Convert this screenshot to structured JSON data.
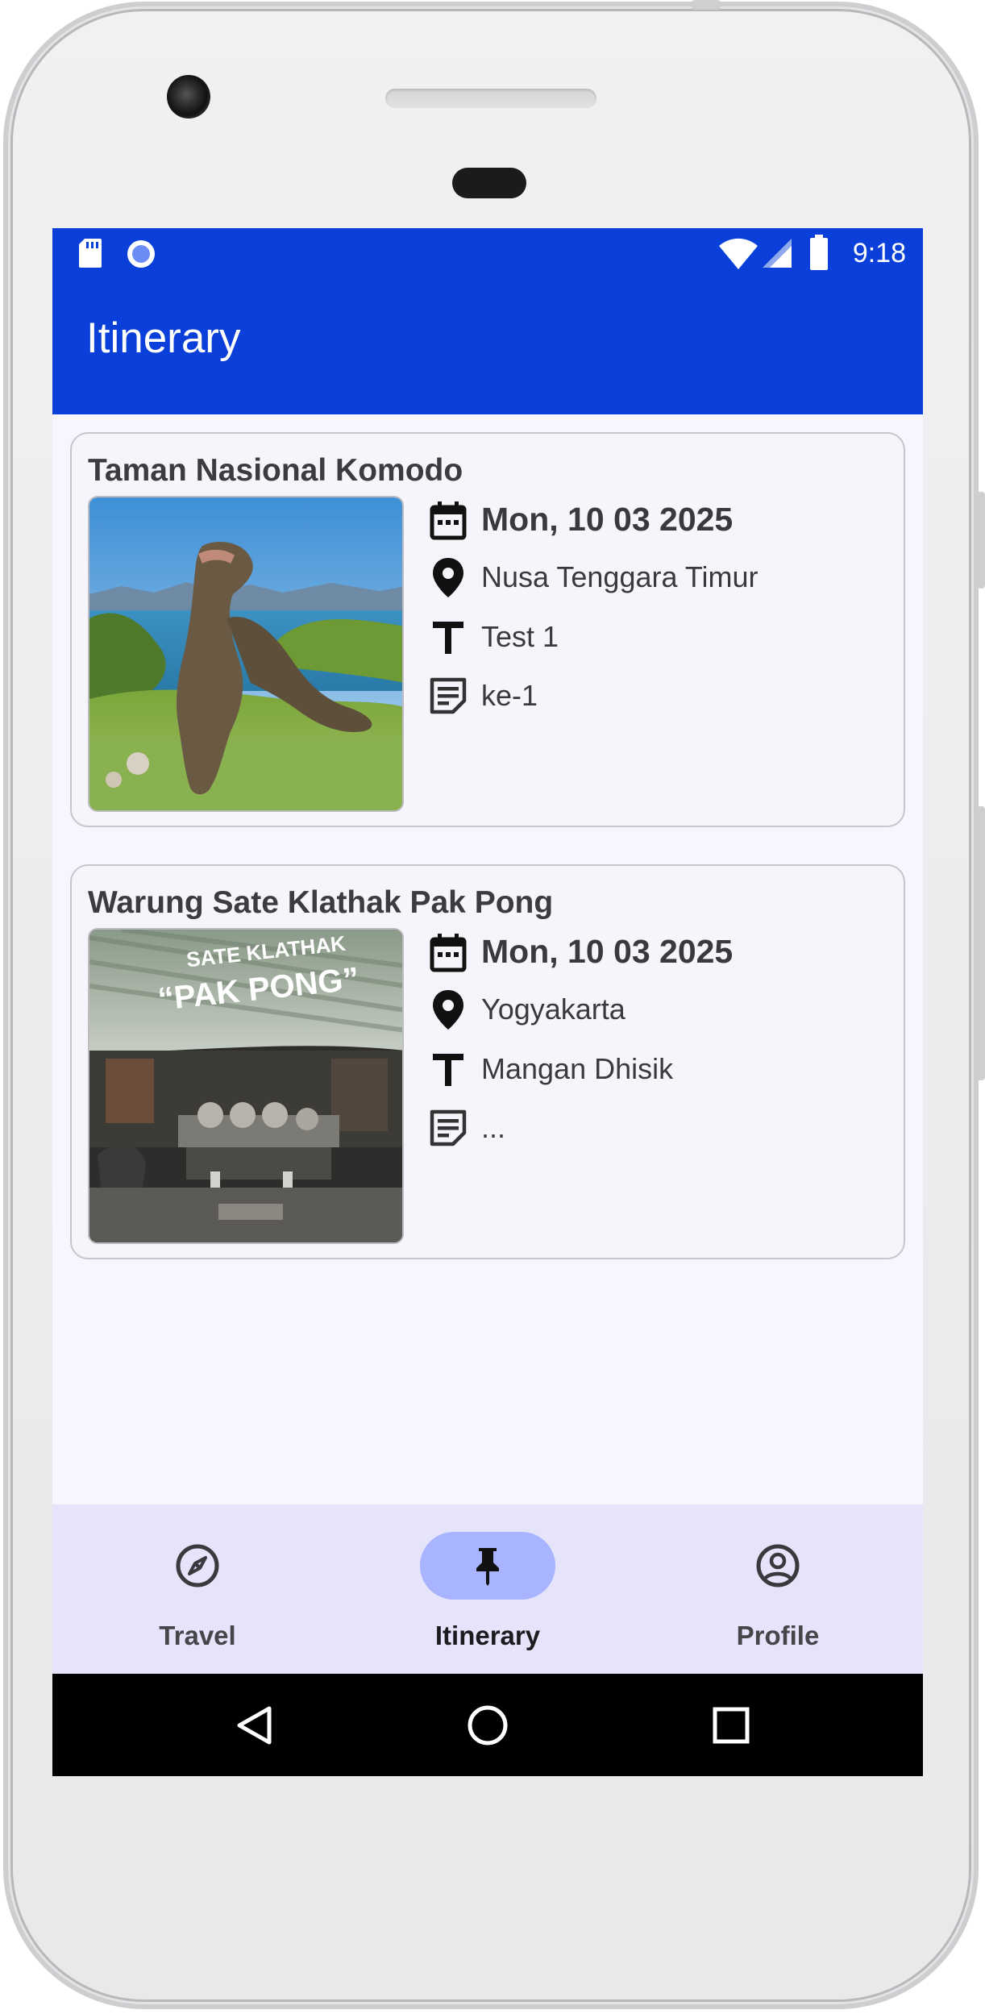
{
  "status_bar": {
    "time": "9:18"
  },
  "app_bar": {
    "title": "Itinerary"
  },
  "itineraries": [
    {
      "title": "Taman Nasional Komodo",
      "date": "Mon, 10 03 2025",
      "location": "Nusa Tenggara Timur",
      "name": "Test 1",
      "note": "ke-1"
    },
    {
      "title": "Warung Sate Klathak Pak Pong",
      "date": "Mon, 10 03 2025",
      "location": "Yogyakarta",
      "name": "Mangan Dhisik",
      "note": "...",
      "image_sign": {
        "line1": "SATE KLATHAK",
        "line2": "“PAK PONG”"
      }
    }
  ],
  "bottom_nav": {
    "items": [
      {
        "label": "Travel",
        "icon": "compass-icon",
        "active": false
      },
      {
        "label": "Itinerary",
        "icon": "pin-icon",
        "active": true
      },
      {
        "label": "Profile",
        "icon": "account-circle-icon",
        "active": false
      }
    ]
  },
  "colors": {
    "primary": "#0a3fd9",
    "surface": "#f7f5fd",
    "nav_background": "#e5e4fb",
    "nav_active_indicator": "#a8b4ff"
  }
}
